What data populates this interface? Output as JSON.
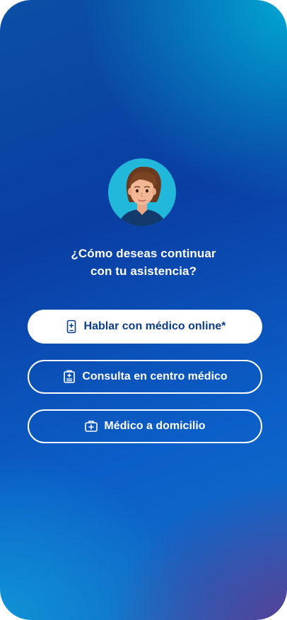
{
  "avatar": {
    "icon": "doctor-avatar-icon"
  },
  "prompt": {
    "line1": "¿Cómo deseas continuar",
    "line2": "con tu asistencia?"
  },
  "options": [
    {
      "label": "Hablar con médico online*",
      "icon": "phone-medical-icon"
    },
    {
      "label": "Consulta en centro médico",
      "icon": "clinic-icon"
    },
    {
      "label": "Médico a domicilio",
      "icon": "medical-kit-icon"
    }
  ],
  "colors": {
    "primary_text": "#0a3e8c",
    "accent_circle": "#22b8dc",
    "background_top": "#00afd7",
    "background_mid": "#0a3ea3",
    "background_corner": "#64378c"
  }
}
